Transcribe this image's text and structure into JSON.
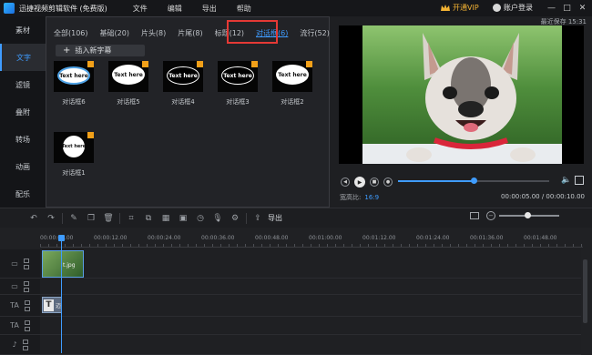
{
  "app": {
    "title": "迅捷视频剪辑软件 (免费版)",
    "menus": [
      "文件",
      "编辑",
      "导出",
      "帮助"
    ],
    "vip": "开通VIP",
    "login": "账户登录",
    "window_controls": [
      "minimize-icon",
      "maximize-icon",
      "close-icon"
    ]
  },
  "sidebar": {
    "items": [
      {
        "label": "素材"
      },
      {
        "label": "文字",
        "active": true
      },
      {
        "label": "滤镜"
      },
      {
        "label": "叠附"
      },
      {
        "label": "转场"
      },
      {
        "label": "动画"
      },
      {
        "label": "配乐"
      }
    ]
  },
  "media": {
    "tabs": [
      {
        "label": "全部(106)"
      },
      {
        "label": "基础(20)"
      },
      {
        "label": "片头(8)"
      },
      {
        "label": "片尾(8)"
      },
      {
        "label": "标题(12)"
      },
      {
        "label": "对话框(6)",
        "active": true
      },
      {
        "label": "流行(52)"
      }
    ],
    "insert_button": "插入新字幕",
    "items": [
      {
        "label": "对话框6",
        "thumb_text": "Text here",
        "style": "blue"
      },
      {
        "label": "对话框5",
        "thumb_text": "Text here",
        "style": "cloud"
      },
      {
        "label": "对话框4",
        "thumb_text": "Text here",
        "style": "dark"
      },
      {
        "label": "对话框3",
        "thumb_text": "Text here",
        "style": "dark"
      },
      {
        "label": "对话框2",
        "thumb_text": "Text here",
        "style": "cloud"
      },
      {
        "label": "对话框1",
        "thumb_text": "Text here",
        "style": "round"
      }
    ]
  },
  "preview": {
    "autosave": "最近保存 15:31",
    "ratio_label": "宽高比:",
    "ratio_value": "16:9",
    "timecode": "00:00:05.00 / 00:00:10.00",
    "progress": 0.5
  },
  "toolbar": {
    "export_label": "导出"
  },
  "timeline": {
    "ruler": [
      "00:00:00.00",
      "00:00:12.00",
      "00:00:24.00",
      "00:00:36.00",
      "00:00:48.00",
      "00:01:00.00",
      "00:01:12.00",
      "00:01:24.00",
      "00:01:36.00",
      "00:01:48.00"
    ],
    "text_clip_label": "迈",
    "video_clip_label": "t.jpg"
  },
  "colors": {
    "accent": "#3f9cff",
    "vip": "#f2b233",
    "highlight_box": "#e53935"
  }
}
